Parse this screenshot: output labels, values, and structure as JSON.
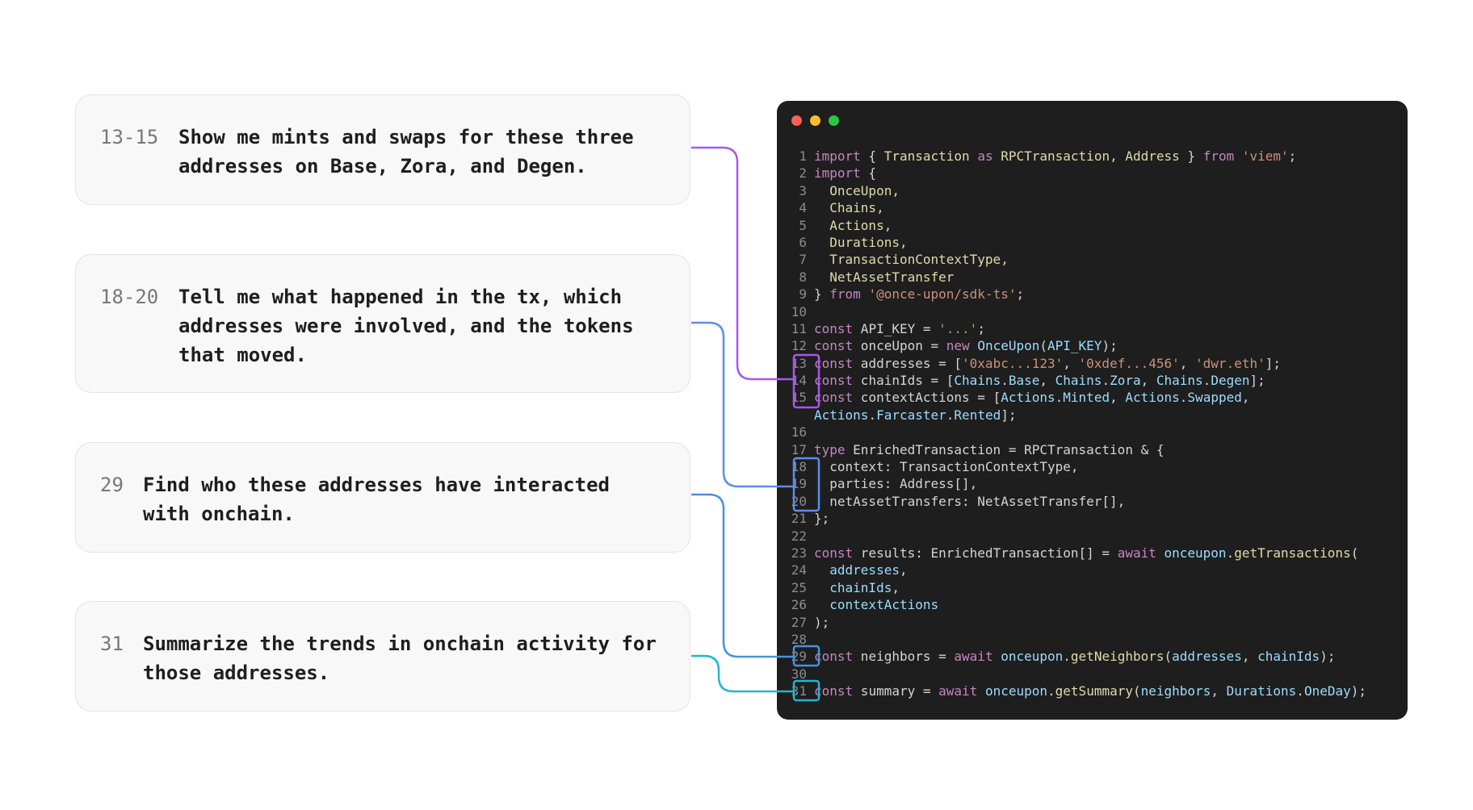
{
  "window": {
    "traffic_lights": {
      "close_color": "#ff5f57",
      "minimize_color": "#febc2e",
      "maximize_color": "#28c840"
    }
  },
  "prompts": [
    {
      "range": "13-15",
      "text": "Show me mints and swaps for these three addresses on Base, Zora, and Degen.",
      "lines": [
        "Show me mints and swaps for these three",
        "addresses on Base, Zora, and Degen."
      ],
      "accent": "#a855f7"
    },
    {
      "range": "18-20",
      "text": "Tell me what happened in the tx, which addresses were involved, and the tokens that moved.",
      "lines": [
        "Tell me what happened in the tx, which",
        "addresses were involved, and the tokens",
        "that moved."
      ],
      "accent": "#5b8def"
    },
    {
      "range": "29",
      "text": "Find who these addresses have interacted with onchain.",
      "lines": [
        "Find who these addresses have interacted",
        "with onchain."
      ],
      "accent": "#4a90e2"
    },
    {
      "range": "31",
      "text": "Summarize the trends in onchain activity for those addresses.",
      "lines": [
        "Summarize the trends in onchain activity for",
        "those addresses."
      ],
      "accent": "#22b5d4"
    }
  ],
  "code_lines": [
    {
      "n": "1",
      "tokens": [
        [
          "kw",
          "import"
        ],
        [
          "plain",
          " { "
        ],
        [
          "fn",
          "Transaction"
        ],
        [
          "plain",
          " "
        ],
        [
          "kw",
          "as"
        ],
        [
          "plain",
          " "
        ],
        [
          "fn",
          "RPCTransaction"
        ],
        [
          "plain",
          ", "
        ],
        [
          "fn",
          "Address"
        ],
        [
          "plain",
          " } "
        ],
        [
          "kw",
          "from"
        ],
        [
          "plain",
          " "
        ],
        [
          "str",
          "'viem'"
        ],
        [
          "plain",
          ";"
        ]
      ]
    },
    {
      "n": "2",
      "tokens": [
        [
          "kw",
          "import"
        ],
        [
          "plain",
          " {"
        ]
      ]
    },
    {
      "n": "3",
      "tokens": [
        [
          "plain",
          "  "
        ],
        [
          "fn",
          "OnceUpon"
        ],
        [
          "plain",
          ","
        ]
      ]
    },
    {
      "n": "4",
      "tokens": [
        [
          "plain",
          "  "
        ],
        [
          "fn",
          "Chains"
        ],
        [
          "plain",
          ","
        ]
      ]
    },
    {
      "n": "5",
      "tokens": [
        [
          "plain",
          "  "
        ],
        [
          "fn",
          "Actions"
        ],
        [
          "plain",
          ","
        ]
      ]
    },
    {
      "n": "6",
      "tokens": [
        [
          "plain",
          "  "
        ],
        [
          "fn",
          "Durations"
        ],
        [
          "plain",
          ","
        ]
      ]
    },
    {
      "n": "7",
      "tokens": [
        [
          "plain",
          "  "
        ],
        [
          "fn",
          "TransactionContextType"
        ],
        [
          "plain",
          ","
        ]
      ]
    },
    {
      "n": "8",
      "tokens": [
        [
          "plain",
          "  "
        ],
        [
          "fn",
          "NetAssetTransfer"
        ]
      ]
    },
    {
      "n": "9",
      "tokens": [
        [
          "plain",
          "} "
        ],
        [
          "kw",
          "from"
        ],
        [
          "plain",
          " "
        ],
        [
          "str",
          "'@once-upon/sdk-ts'"
        ],
        [
          "plain",
          ";"
        ]
      ]
    },
    {
      "n": "10",
      "tokens": []
    },
    {
      "n": "11",
      "tokens": [
        [
          "kw",
          "const"
        ],
        [
          "plain",
          " API_KEY = "
        ],
        [
          "str",
          "'...'"
        ],
        [
          "plain",
          ";"
        ]
      ]
    },
    {
      "n": "12",
      "tokens": [
        [
          "kw",
          "const"
        ],
        [
          "plain",
          " onceUpon = "
        ],
        [
          "kw",
          "new"
        ],
        [
          "plain",
          " "
        ],
        [
          "var",
          "OnceUpon"
        ],
        [
          "plain",
          "("
        ],
        [
          "var",
          "API_KEY"
        ],
        [
          "plain",
          ");"
        ]
      ]
    },
    {
      "n": "13",
      "tokens": [
        [
          "kw",
          "const"
        ],
        [
          "plain",
          " addresses = ["
        ],
        [
          "str",
          "'0xabc...123'"
        ],
        [
          "plain",
          ", "
        ],
        [
          "str",
          "'0xdef...456'"
        ],
        [
          "plain",
          ", "
        ],
        [
          "str",
          "'dwr.eth'"
        ],
        [
          "plain",
          "];"
        ]
      ]
    },
    {
      "n": "14",
      "tokens": [
        [
          "kw",
          "const"
        ],
        [
          "plain",
          " chainIds = ["
        ],
        [
          "var",
          "Chains"
        ],
        [
          "plain",
          "."
        ],
        [
          "var",
          "Base"
        ],
        [
          "plain",
          ", "
        ],
        [
          "var",
          "Chains"
        ],
        [
          "plain",
          "."
        ],
        [
          "var",
          "Zora"
        ],
        [
          "plain",
          ", "
        ],
        [
          "var",
          "Chains"
        ],
        [
          "plain",
          "."
        ],
        [
          "var",
          "Degen"
        ],
        [
          "plain",
          "];"
        ]
      ]
    },
    {
      "n": "15",
      "tokens": [
        [
          "kw",
          "const"
        ],
        [
          "plain",
          " contextActions = ["
        ],
        [
          "var",
          "Actions"
        ],
        [
          "plain",
          "."
        ],
        [
          "var",
          "Minted"
        ],
        [
          "plain",
          ", "
        ],
        [
          "var",
          "Actions"
        ],
        [
          "plain",
          "."
        ],
        [
          "var",
          "Swapped"
        ],
        [
          "plain",
          ","
        ]
      ]
    },
    {
      "n": "",
      "tokens": [
        [
          "var",
          "Actions"
        ],
        [
          "plain",
          "."
        ],
        [
          "var",
          "Farcaster"
        ],
        [
          "plain",
          "."
        ],
        [
          "var",
          "Rented"
        ],
        [
          "plain",
          "];"
        ]
      ]
    },
    {
      "n": "16",
      "tokens": []
    },
    {
      "n": "17",
      "tokens": [
        [
          "kw",
          "type"
        ],
        [
          "plain",
          " EnrichedTransaction = RPCTransaction & {"
        ]
      ]
    },
    {
      "n": "18",
      "tokens": [
        [
          "plain",
          "  context: TransactionContextType,"
        ]
      ]
    },
    {
      "n": "19",
      "tokens": [
        [
          "plain",
          "  parties: Address[],"
        ]
      ]
    },
    {
      "n": "20",
      "tokens": [
        [
          "plain",
          "  netAssetTransfers: NetAssetTransfer[],"
        ]
      ]
    },
    {
      "n": "21",
      "tokens": [
        [
          "plain",
          "};"
        ]
      ]
    },
    {
      "n": "22",
      "tokens": []
    },
    {
      "n": "23",
      "tokens": [
        [
          "kw",
          "const"
        ],
        [
          "plain",
          " results: EnrichedTransaction[] = "
        ],
        [
          "kw",
          "await"
        ],
        [
          "plain",
          " "
        ],
        [
          "var",
          "onceupon"
        ],
        [
          "plain",
          "."
        ],
        [
          "fn",
          "getTransactions"
        ],
        [
          "plain",
          "("
        ]
      ]
    },
    {
      "n": "24",
      "tokens": [
        [
          "plain",
          "  "
        ],
        [
          "var",
          "addresses"
        ],
        [
          "plain",
          ","
        ]
      ]
    },
    {
      "n": "25",
      "tokens": [
        [
          "plain",
          "  "
        ],
        [
          "var",
          "chainIds"
        ],
        [
          "plain",
          ","
        ]
      ]
    },
    {
      "n": "26",
      "tokens": [
        [
          "plain",
          "  "
        ],
        [
          "var",
          "contextActions"
        ]
      ]
    },
    {
      "n": "27",
      "tokens": [
        [
          "plain",
          ");"
        ]
      ]
    },
    {
      "n": "28",
      "tokens": []
    },
    {
      "n": "29",
      "tokens": [
        [
          "kw",
          "const"
        ],
        [
          "plain",
          " neighbors = "
        ],
        [
          "kw",
          "await"
        ],
        [
          "plain",
          " "
        ],
        [
          "var",
          "onceupon"
        ],
        [
          "plain",
          "."
        ],
        [
          "fn",
          "getNeighbors"
        ],
        [
          "plain",
          "("
        ],
        [
          "var",
          "addresses"
        ],
        [
          "plain",
          ", "
        ],
        [
          "var",
          "chainIds"
        ],
        [
          "plain",
          ");"
        ]
      ]
    },
    {
      "n": "30",
      "tokens": []
    },
    {
      "n": "31",
      "tokens": [
        [
          "kw",
          "const"
        ],
        [
          "plain",
          " summary = "
        ],
        [
          "kw",
          "await"
        ],
        [
          "plain",
          " "
        ],
        [
          "var",
          "onceupon"
        ],
        [
          "plain",
          "."
        ],
        [
          "fn",
          "getSummary"
        ],
        [
          "plain",
          "("
        ],
        [
          "var",
          "neighbors"
        ],
        [
          "plain",
          ", "
        ],
        [
          "var",
          "Durations"
        ],
        [
          "plain",
          "."
        ],
        [
          "var",
          "OneDay"
        ],
        [
          "plain",
          ");"
        ]
      ]
    }
  ]
}
